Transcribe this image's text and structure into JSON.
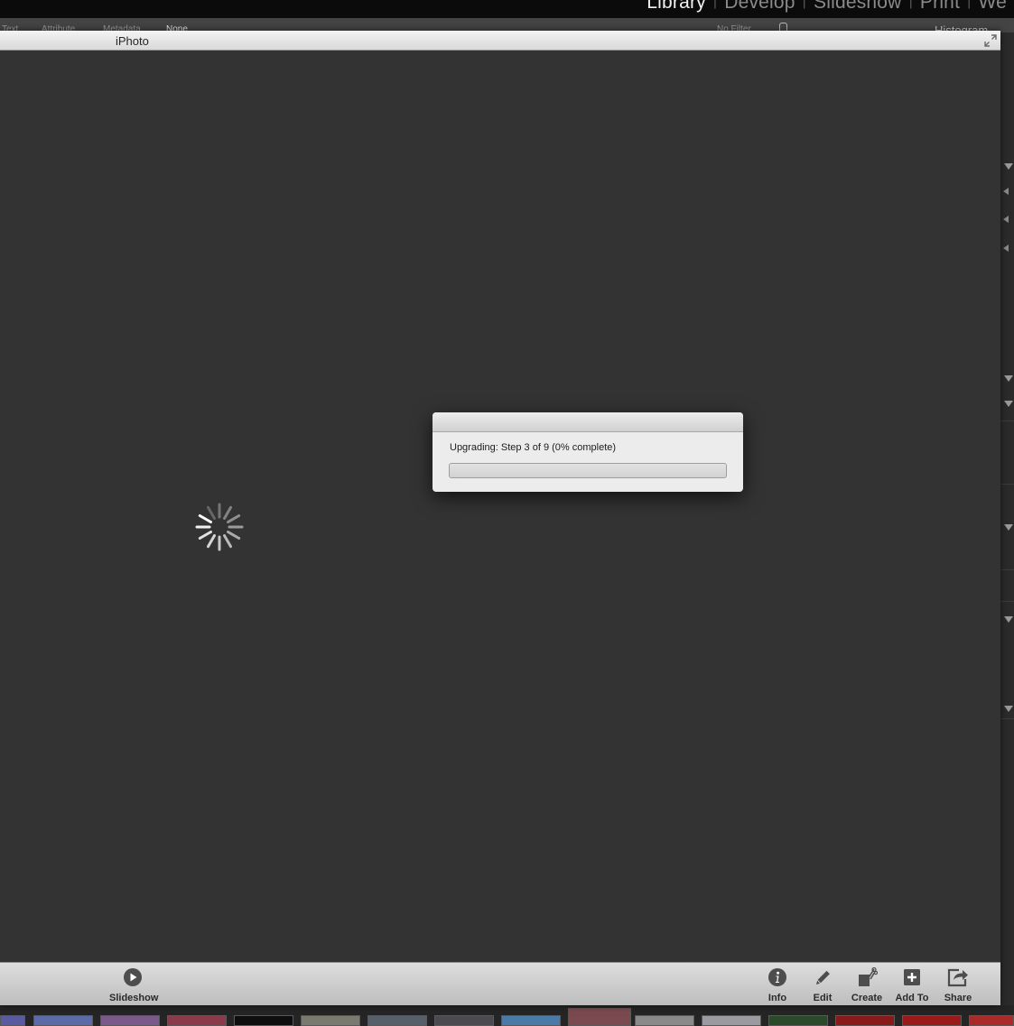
{
  "lightroom": {
    "modules": [
      {
        "label": "Library",
        "active": true
      },
      {
        "label": "Develop",
        "active": false
      },
      {
        "label": "Slideshow",
        "active": false
      },
      {
        "label": "Print",
        "active": false
      },
      {
        "label": "We",
        "active": false
      }
    ],
    "filter_bar": {
      "text": "Text",
      "attribute": "Attribute",
      "metadata": "Metadata",
      "none": "None",
      "no_filter": "No Filter"
    },
    "right_panel": {
      "histogram_label": "Histogram"
    }
  },
  "iphoto": {
    "window_title": "iPhoto",
    "progress": {
      "label": "Upgrading: Step 3 of 9 (0% complete)",
      "percent": 0
    },
    "toolbar": {
      "slideshow": "Slideshow",
      "info": "Info",
      "edit": "Edit",
      "create": "Create",
      "add_to": "Add To",
      "share": "Share"
    }
  },
  "colors": {
    "content_bg": "#333333",
    "dialog_bg": "#ececec",
    "active_module": "#f2f2f2"
  },
  "icons": [
    "play-icon",
    "info-icon",
    "pencil-icon",
    "create-icon",
    "add-icon",
    "share-icon",
    "fullscreen-icon",
    "spinner-icon"
  ]
}
